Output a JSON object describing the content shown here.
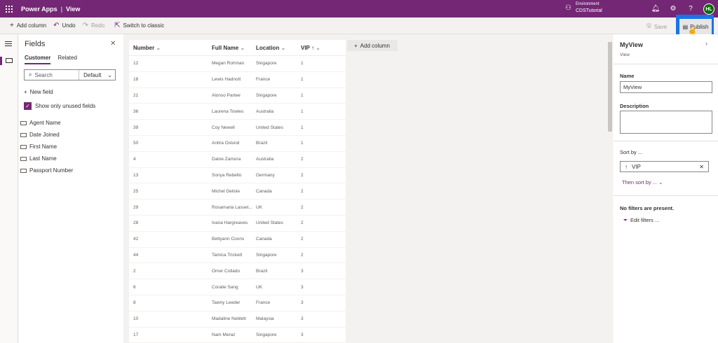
{
  "header": {
    "app_name": "Power Apps",
    "separator": "|",
    "page": "View",
    "env_label": "Environment",
    "env_name": "CDSTutorial",
    "avatar_initials": "HL",
    "brand_color": "#742774"
  },
  "commands": {
    "add_column": "Add column",
    "undo": "Undo",
    "redo": "Redo",
    "switch_classic": "Switch to classic",
    "save": "Save",
    "publish": "Publish"
  },
  "fields_panel": {
    "title": "Fields",
    "tabs": [
      "Customer",
      "Related"
    ],
    "search_placeholder": "Search",
    "filter_value": "Default",
    "new_field": "New field",
    "show_unused": "Show only unused fields",
    "items": [
      "Agent Name",
      "Date Joined",
      "First Name",
      "Last Name",
      "Passport Number"
    ]
  },
  "grid": {
    "columns": [
      "Number",
      "Full Name",
      "Location",
      "VIP"
    ],
    "add_column": "Add column",
    "rows": [
      [
        "12",
        "Megan Rohman",
        "Singapore",
        "1"
      ],
      [
        "18",
        "Lewis Hadnott",
        "France",
        "1"
      ],
      [
        "21",
        "Alonso Partee",
        "Singapore",
        "1"
      ],
      [
        "36",
        "Laurena Towles",
        "Australia",
        "1"
      ],
      [
        "39",
        "Coy Newell",
        "United States",
        "1"
      ],
      [
        "50",
        "Anitra Oslund",
        "Brazil",
        "1"
      ],
      [
        "4",
        "Daine Zamora",
        "Australia",
        "2"
      ],
      [
        "13",
        "Sonya Rebello",
        "Germany",
        "2"
      ],
      [
        "25",
        "Michel Delisle",
        "Canada",
        "2"
      ],
      [
        "29",
        "Rosamaria Lasset...",
        "UK",
        "2"
      ],
      [
        "28",
        "Ivana Hargreaves",
        "United States",
        "2"
      ],
      [
        "42",
        "Bettyann Coons",
        "Canada",
        "2"
      ],
      [
        "44",
        "Tamica Trickett",
        "Singapore",
        "2"
      ],
      [
        "2",
        "Omer Collado",
        "Brazil",
        "3"
      ],
      [
        "6",
        "Coralie Sang",
        "UK",
        "3"
      ],
      [
        "8",
        "Tawny Leeder",
        "France",
        "3"
      ],
      [
        "10",
        "Madaline Neblett",
        "Malaysia",
        "3"
      ],
      [
        "17",
        "Nam Meraz",
        "Singapore",
        "3"
      ]
    ]
  },
  "properties": {
    "title": "MyView",
    "subtitle": "View",
    "name_label": "Name",
    "name_value": "MyView",
    "description_label": "Description",
    "sort_label": "Sort by ...",
    "sort_value": "VIP",
    "then_sort": "Then sort by ...",
    "no_filters": "No filters are present.",
    "edit_filters": "Edit filters ..."
  }
}
